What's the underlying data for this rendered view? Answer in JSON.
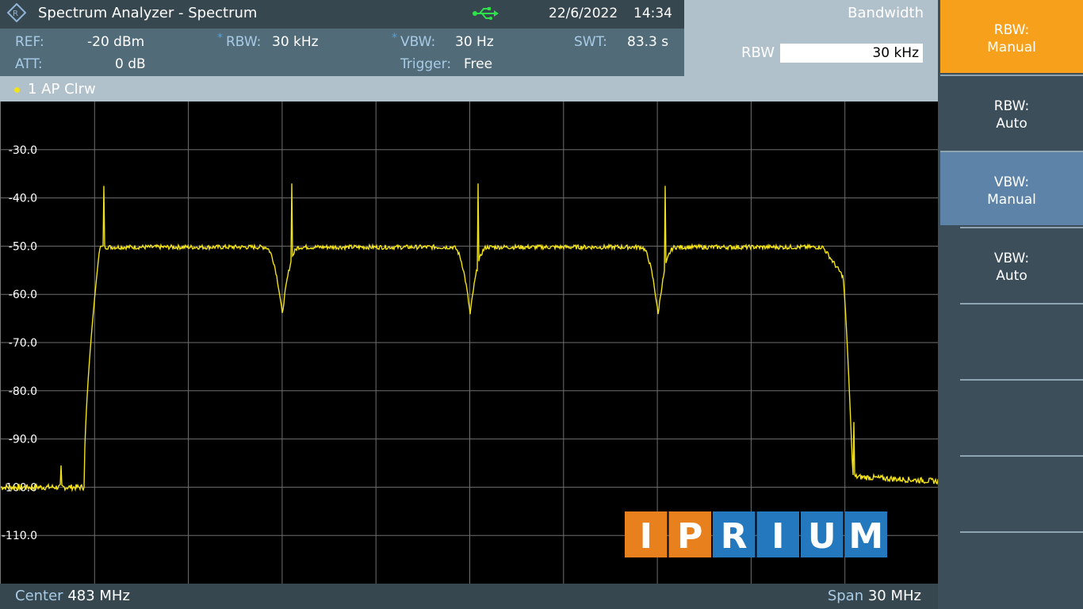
{
  "window": {
    "title": "Spectrum Analyzer - Spectrum",
    "date": "22/6/2022",
    "time": "14:34"
  },
  "menu": {
    "title": "Bandwidth",
    "input_label": "RBW",
    "input_value": "30 kHz"
  },
  "settings": {
    "ref_label": "REF:",
    "ref_value": "-20 dBm",
    "att_label": "ATT:",
    "att_value": "0 dB",
    "rbw_label": "RBW:",
    "rbw_value": "30 kHz",
    "vbw_label": "VBW:",
    "vbw_value": "30 Hz",
    "trigger_label": "Trigger:",
    "trigger_value": "Free",
    "swt_label": "SWT:",
    "swt_value": "83.3 s",
    "modified_marker": "*"
  },
  "trace": {
    "label": "1 AP  Clrw",
    "color": "#f2e21a"
  },
  "axis": {
    "y_ticks": [
      "-30.0",
      "-40.0",
      "-50.0",
      "-60.0",
      "-70.0",
      "-80.0",
      "-90.0",
      "-100.0",
      "-110.0"
    ],
    "y_range_db": [
      -20,
      -120
    ]
  },
  "footer": {
    "center_label": "Center",
    "center_value": "483 MHz",
    "span_label": "Span",
    "span_value": "30 MHz"
  },
  "watermark": {
    "letters": [
      "I",
      "P",
      "R",
      "I",
      "U",
      "M"
    ],
    "colors": [
      "#e8801e",
      "#e8801e",
      "#2378be",
      "#2378be",
      "#2378be",
      "#2378be"
    ]
  },
  "softkeys": [
    {
      "line1": "RBW:",
      "line2": "Manual",
      "state": "active"
    },
    {
      "line1": "RBW:",
      "line2": "Auto",
      "state": "normal"
    },
    {
      "line1": "VBW:",
      "line2": "Manual",
      "state": "selected"
    },
    {
      "line1": "VBW:",
      "line2": "Auto",
      "state": "normal"
    },
    {
      "line1": "",
      "line2": "",
      "state": "normal"
    },
    {
      "line1": "",
      "line2": "",
      "state": "normal"
    },
    {
      "line1": "",
      "line2": "",
      "state": "normal"
    },
    {
      "line1": "",
      "line2": "",
      "state": "normal"
    }
  ]
}
